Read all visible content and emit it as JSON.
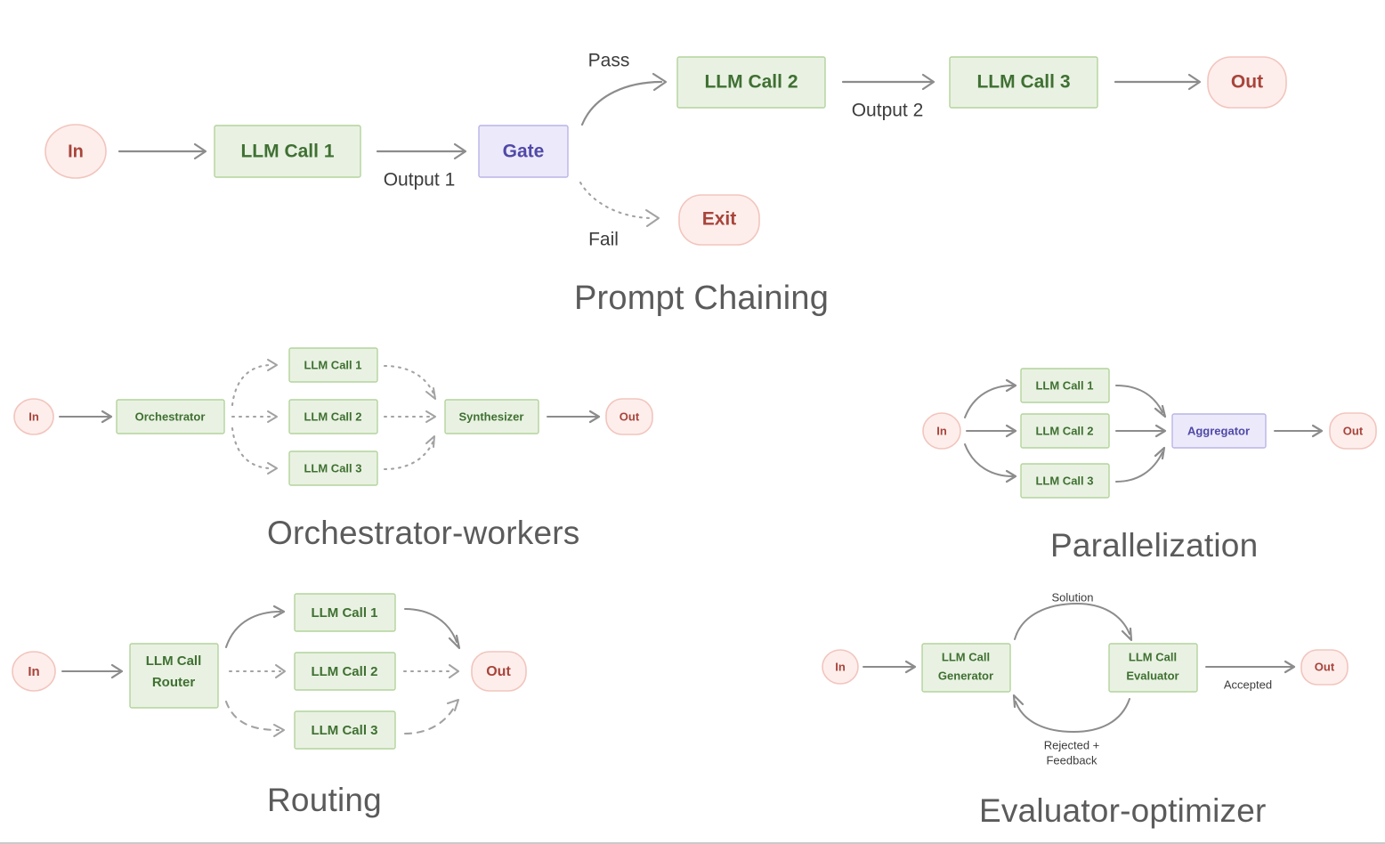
{
  "figure": {
    "caption_color": "#5b5b5b",
    "colors": {
      "llm_fill": "#e9f2e2",
      "llm_stroke": "#b3d39c",
      "llm_text": "#3f7032",
      "gate_fill": "#eceafa",
      "gate_stroke": "#b9b4e6",
      "gate_text": "#5049a8",
      "io_fill": "#fdeeec",
      "io_stroke": "#f2c5bd",
      "io_text": "#a8443a",
      "arrow": "#8c8c8c",
      "background": "#ffffff"
    }
  },
  "panels": {
    "prompt_chaining": {
      "title": "Prompt Chaining",
      "nodes": {
        "in": "In",
        "llm_call_1": "LLM Call 1",
        "gate": "Gate",
        "llm_call_2": "LLM Call 2",
        "llm_call_3": "LLM Call 3",
        "out": "Out",
        "exit": "Exit"
      },
      "edge_labels": {
        "output_1": "Output 1",
        "output_2": "Output 2",
        "pass": "Pass",
        "fail": "Fail"
      }
    },
    "orchestrator_workers": {
      "title": "Orchestrator-workers",
      "nodes": {
        "in": "In",
        "orchestrator": "Orchestrator",
        "llm_call_1": "LLM Call 1",
        "llm_call_2": "LLM Call 2",
        "llm_call_3": "LLM Call 3",
        "synthesizer": "Synthesizer",
        "out": "Out"
      }
    },
    "parallelization": {
      "title": "Parallelization",
      "nodes": {
        "in": "In",
        "llm_call_1": "LLM Call 1",
        "llm_call_2": "LLM Call 2",
        "llm_call_3": "LLM Call 3",
        "aggregator": "Aggregator",
        "out": "Out"
      }
    },
    "routing": {
      "title": "Routing",
      "nodes": {
        "in": "In",
        "router_line1": "LLM Call",
        "router_line2": "Router",
        "llm_call_1": "LLM Call 1",
        "llm_call_2": "LLM Call 2",
        "llm_call_3": "LLM Call 3",
        "out": "Out"
      }
    },
    "evaluator_optimizer": {
      "title": "Evaluator-optimizer",
      "nodes": {
        "in": "In",
        "generator_line1": "LLM Call",
        "generator_line2": "Generator",
        "evaluator_line1": "LLM Call",
        "evaluator_line2": "Evaluator",
        "out": "Out"
      },
      "edge_labels": {
        "solution": "Solution",
        "rejected_line1": "Rejected +",
        "rejected_line2": "Feedback",
        "accepted": "Accepted"
      }
    }
  }
}
